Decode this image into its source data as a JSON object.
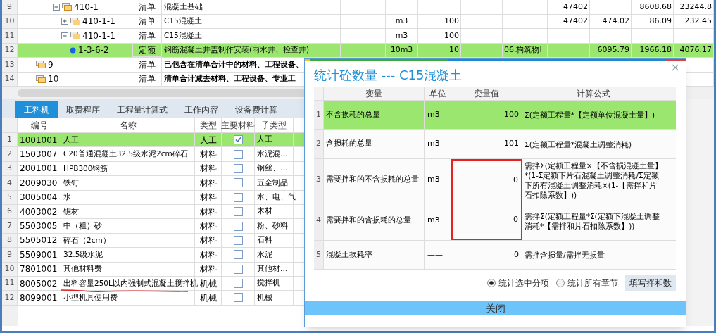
{
  "top_grid": {
    "rows": [
      {
        "num": "9",
        "code": "410-1",
        "type": "清单",
        "name": "混凝土基础",
        "expanded": true,
        "selected": false,
        "bold": false,
        "kind": "group",
        "cells": {
          "col_9": "47402",
          "col_11": "8608.68",
          "col_12": "23244.8"
        },
        "children": [
          {
            "num": "10",
            "code": "410-1-1",
            "type": "清单",
            "name": "C15混凝土",
            "expanded": false,
            "selected": false,
            "bold": false,
            "kind": "group",
            "cells": {
              "unit": "m3",
              "quantity": "100",
              "col_9": "47402",
              "col_10": "474.02",
              "col_11": "86.09",
              "col_12": "232.45"
            }
          },
          {
            "num": "11",
            "code": "410-1-1",
            "type": "清单",
            "name": "C15混凝土",
            "expanded": true,
            "selected": false,
            "bold": false,
            "kind": "group",
            "cells": {
              "unit": "m3",
              "quantity": "100"
            },
            "children": [
              {
                "num": "12",
                "code": "1-3-6-2",
                "type": "定额",
                "name": "钢筋混凝土井盖制作安装(雨水井、检查井)",
                "selected": true,
                "bold": false,
                "kind": "quota",
                "cells": {
                  "unit": "10m3",
                  "quantity": "10",
                  "category": "06.构筑物Ⅰ",
                  "col_10": "6095.79",
                  "col_11": "1966.18",
                  "col_12": "4076.17"
                }
              }
            ]
          }
        ]
      },
      {
        "num": "13",
        "code": "9",
        "type": "清单",
        "name": "已包含在清单合计中的材料、工程设备、",
        "selected": false,
        "bold": true,
        "kind": "group",
        "cells": {}
      },
      {
        "num": "14",
        "code": "10",
        "type": "清单",
        "name": "清单合计减去材料、工程设备、专业工",
        "selected": false,
        "bold": true,
        "kind": "group",
        "cells": {}
      }
    ]
  },
  "tabs": [
    {
      "label": "工料机",
      "selected": true
    },
    {
      "label": "取费程序",
      "selected": false
    },
    {
      "label": "工程量计算式",
      "selected": false
    },
    {
      "label": "工作内容",
      "selected": false
    },
    {
      "label": "设备费计算",
      "selected": false
    }
  ],
  "resource_grid": {
    "columns": [
      "编号",
      "名称",
      "类型",
      "主要材料",
      "子类型"
    ],
    "rows": [
      {
        "num": "1",
        "code": "1001001",
        "name": "人工",
        "type": "人工",
        "main_material": true,
        "subtype": "人工",
        "selected": true,
        "underlined": false
      },
      {
        "num": "2",
        "code": "1503007",
        "name": "C20普通混凝土32.5级水泥2cm碎石",
        "type": "材料",
        "main_material": false,
        "subtype": "水泥混...",
        "selected": false,
        "underlined": false
      },
      {
        "num": "3",
        "code": "2001001",
        "name": "HPB300钢筋",
        "type": "材料",
        "main_material": false,
        "subtype": "钢丝、...",
        "selected": false,
        "underlined": false
      },
      {
        "num": "4",
        "code": "2009030",
        "name": "铁钉",
        "type": "材料",
        "main_material": false,
        "subtype": "五金制品",
        "selected": false,
        "underlined": false
      },
      {
        "num": "5",
        "code": "3005004",
        "name": "水",
        "type": "材料",
        "main_material": false,
        "subtype": "水、电、气",
        "selected": false,
        "underlined": false
      },
      {
        "num": "6",
        "code": "4003002",
        "name": "锯材",
        "type": "材料",
        "main_material": false,
        "subtype": "木材",
        "selected": false,
        "underlined": false
      },
      {
        "num": "7",
        "code": "5503005",
        "name": "中（粗）砂",
        "type": "材料",
        "main_material": false,
        "subtype": "粉、砂料",
        "selected": false,
        "underlined": false
      },
      {
        "num": "8",
        "code": "5505012",
        "name": "碎石（2cm）",
        "type": "材料",
        "main_material": false,
        "subtype": "石料",
        "selected": false,
        "underlined": false
      },
      {
        "num": "9",
        "code": "5509001",
        "name": "32.5级水泥",
        "type": "材料",
        "main_material": false,
        "subtype": "水泥",
        "selected": false,
        "underlined": false
      },
      {
        "num": "10",
        "code": "7801001",
        "name": "其他材料费",
        "type": "材料",
        "main_material": false,
        "subtype": "其他材...",
        "selected": false,
        "underlined": false
      },
      {
        "num": "11",
        "code": "8005002",
        "name": "出料容量250L以内强制式混凝土搅拌机",
        "type": "机械",
        "main_material": false,
        "subtype": "搅拌机",
        "selected": false,
        "underlined": true
      },
      {
        "num": "12",
        "code": "8099001",
        "name": "小型机具使用费",
        "type": "机械",
        "main_material": false,
        "subtype": "机械",
        "selected": false,
        "underlined": false
      }
    ]
  },
  "dialog": {
    "title": "统计砼数量 --- C15混凝土",
    "close_glyph": "×",
    "columns": [
      "变量",
      "单位",
      "变量值",
      "计算公式"
    ],
    "rows": [
      {
        "num": "1",
        "variable": "不含损耗的总量",
        "unit": "m3",
        "value": "100",
        "formula": "Σ(定额工程量*【定额单位混凝土量】)",
        "selected": true,
        "boxed": false
      },
      {
        "num": "2",
        "variable": "含损耗的总量",
        "unit": "m3",
        "value": "101",
        "formula": "Σ(定额工程量*混凝土调整消耗)",
        "selected": false,
        "boxed": false
      },
      {
        "num": "3",
        "variable": "需要拌和的不含损耗的总量",
        "unit": "m3",
        "value": "0",
        "formula": "需拌Σ(定额工程量×【不含损混凝土量】*(1-Σ定额下片石混凝土调整消耗/Σ定额下所有混凝土调整消耗×(1-【需拌和片石扣除系数】))",
        "selected": false,
        "boxed": true
      },
      {
        "num": "4",
        "variable": "需要拌和的含损耗的总量",
        "unit": "m3",
        "value": "0",
        "formula": "需拌Σ(定额工程量*Σ(定额下混凝土调整消耗*【需拌和片石扣除系数】))",
        "selected": false,
        "boxed": true
      },
      {
        "num": "5",
        "variable": "混凝土损耗率",
        "unit": "——",
        "value": "0",
        "formula": "需拌含损量/需拌无损量",
        "selected": false,
        "boxed": false
      }
    ],
    "options": [
      {
        "label": "统计选中分项",
        "selected": true
      },
      {
        "label": "统计所有章节",
        "selected": false
      }
    ],
    "fill_button": "填写拌和数",
    "close_button": "关闭"
  }
}
